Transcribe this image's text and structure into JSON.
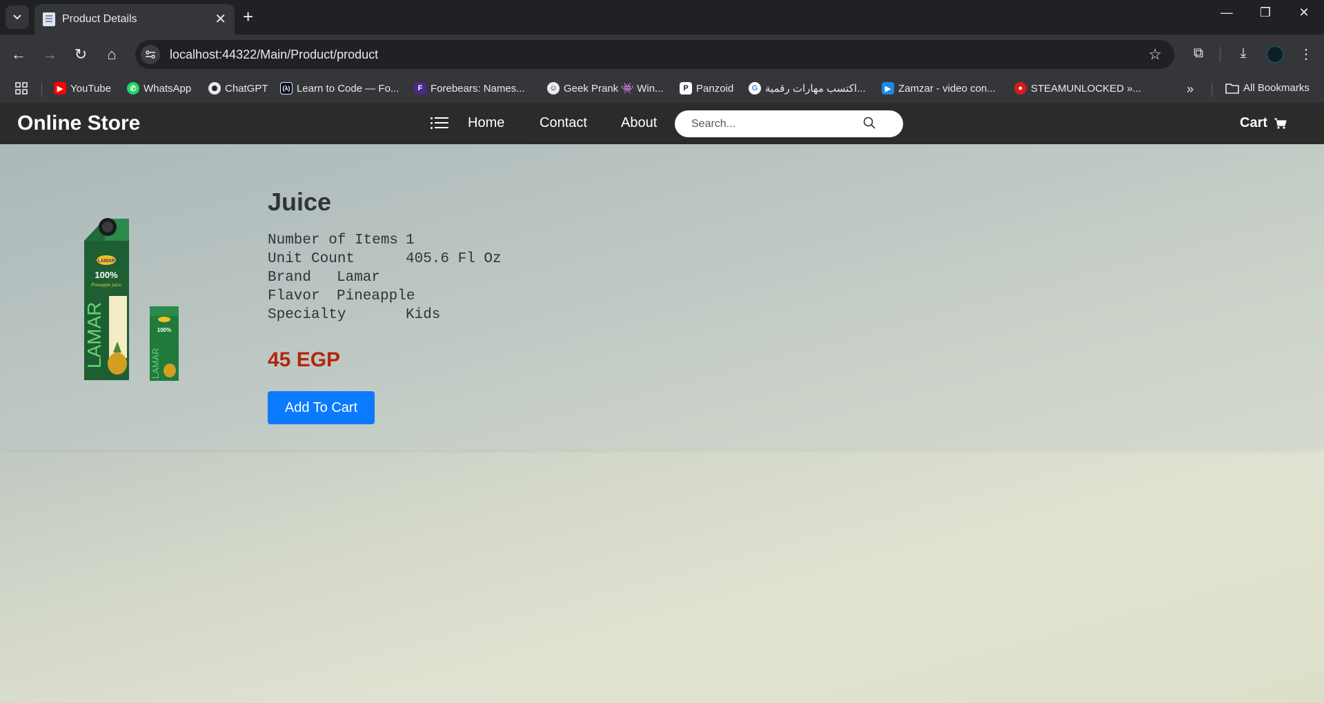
{
  "browser": {
    "tab_title": "Product Details",
    "url": "localhost:44322/Main/Product/product",
    "bookmarks": [
      {
        "label": "YouTube",
        "icon": "youtube-icon",
        "color": "#ff0000"
      },
      {
        "label": "WhatsApp",
        "icon": "whatsapp-icon",
        "color": "#25d366"
      },
      {
        "label": "ChatGPT",
        "icon": "chatgpt-icon",
        "color": "#1a1a1a"
      },
      {
        "label": "Learn to Code — Fo...",
        "icon": "freecodecamp-icon",
        "color": "#0a0a23"
      },
      {
        "label": "Forebears: Names...",
        "icon": "forebears-icon",
        "color": "#4b2a86"
      },
      {
        "label": "Geek Prank 👾 Win...",
        "icon": "geekprank-icon",
        "color": "#3a3a3a"
      },
      {
        "label": "Panzoid",
        "icon": "panzoid-icon",
        "color": "#ffffff"
      },
      {
        "label": "اكتسب مهارات رقمية...",
        "icon": "google-icon",
        "color": "#ffffff"
      },
      {
        "label": "Zamzar - video con...",
        "icon": "zamzar-icon",
        "color": "#1e88e5"
      },
      {
        "label": "STEAMUNLOCKED »...",
        "icon": "steamunlocked-icon",
        "color": "#d81b1b"
      }
    ],
    "all_bookmarks": "All Bookmarks"
  },
  "site": {
    "brand": "Online Store",
    "nav": {
      "home": "Home",
      "contact": "Contact",
      "about": "About"
    },
    "search_placeholder": "Search...",
    "cart": "Cart"
  },
  "product": {
    "title": "Juice",
    "specs": [
      {
        "key": "Number of Items",
        "value": "1"
      },
      {
        "key": "Unit Count",
        "value": "405.6 Fl Oz"
      },
      {
        "key": "Brand",
        "value": "Lamar"
      },
      {
        "key": "Flavor",
        "value": "Pineapple"
      },
      {
        "key": "Specialty",
        "value": "Kids"
      }
    ],
    "price": "45 EGP",
    "add_to_cart": "Add To Cart",
    "image_text": {
      "logo": "LAMAR",
      "badge": "100%",
      "flavor": "Pineapple juice"
    }
  }
}
